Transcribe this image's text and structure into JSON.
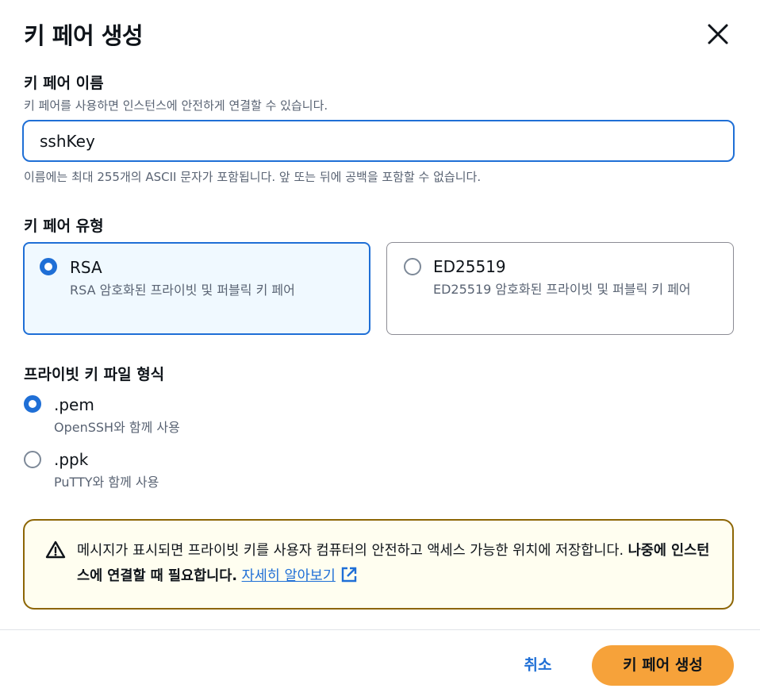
{
  "modal": {
    "title": "키 페어 생성"
  },
  "name_field": {
    "label": "키 페어 이름",
    "description": "키 페어를 사용하면 인스턴스에 안전하게 연결할 수 있습니다.",
    "value": "sshKey",
    "constraint": "이름에는 최대 255개의 ASCII 문자가 포함됩니다. 앞 또는 뒤에 공백을 포함할 수 없습니다."
  },
  "key_type": {
    "label": "키 페어 유형",
    "options": [
      {
        "title": "RSA",
        "description": "RSA 암호화된 프라이빗 및 퍼블릭 키 페어",
        "selected": true
      },
      {
        "title": "ED25519",
        "description": "ED25519 암호화된 프라이빗 및 퍼블릭 키 페어",
        "selected": false
      }
    ]
  },
  "file_format": {
    "label": "프라이빗 키 파일 형식",
    "options": [
      {
        "title": ".pem",
        "description": "OpenSSH와 함께 사용",
        "selected": true
      },
      {
        "title": ".ppk",
        "description": "PuTTY와 함께 사용",
        "selected": false
      }
    ]
  },
  "alert": {
    "text_plain": "메시지가 표시되면 프라이빗 키를 사용자 컴퓨터의 안전하고 액세스 가능한 위치에 저장합니다. ",
    "text_bold": "나중에 인스턴스에 연결할 때 필요합니다.",
    "link": "자세히 알아보기",
    "icon": "warning-icon"
  },
  "footer": {
    "cancel_label": "취소",
    "create_label": "키 페어 생성"
  },
  "colors": {
    "accent": "#1f6fd6",
    "primary_button": "#f6a23a",
    "warning_border": "#8d6605",
    "warning_bg": "#fffef0"
  }
}
